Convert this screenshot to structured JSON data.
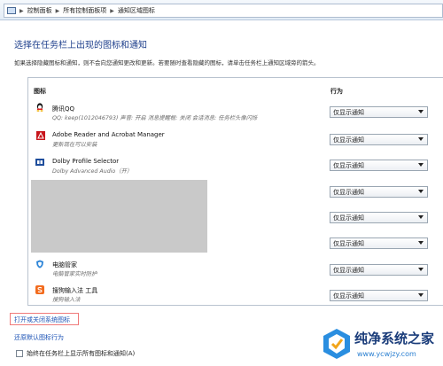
{
  "breadcrumb": [
    "控制面板",
    "所有控制面板项",
    "通知区域图标"
  ],
  "page_title": "选择在任务栏上出现的图标和通知",
  "description": "如果选择隐藏图标和通知，则不会向您通知更改和更新。若要随时查看隐藏的图标，请单击任务栏上通知区域旁的箭头。",
  "columns": {
    "icon": "图标",
    "behavior": "行为"
  },
  "rows": [
    {
      "name": "腾讯QQ",
      "desc": "QQ: keep(1012046793)  声音: 开启  消息提醒框: 关闭  会话消息: 任务栏头像闪烁",
      "behavior": "仅显示通知",
      "icon": "qq-icon"
    },
    {
      "name": "Adobe Reader and Acrobat Manager",
      "desc": "更新现在可以安装",
      "behavior": "仅显示通知",
      "icon": "adobe-icon"
    },
    {
      "name": "Dolby Profile Selector",
      "desc": "Dolby Advanced Audio（开）",
      "behavior": "仅显示通知",
      "icon": "dolby-icon"
    },
    {
      "name": "",
      "desc": "",
      "behavior": "仅显示通知",
      "icon": ""
    },
    {
      "name": "",
      "desc": "",
      "behavior": "仅显示通知",
      "icon": ""
    },
    {
      "name": "",
      "desc": "",
      "behavior": "仅显示通知",
      "icon": ""
    },
    {
      "name": "电脑管家",
      "desc": "电脑管家实时防护",
      "behavior": "仅显示通知",
      "icon": "shield-icon"
    },
    {
      "name": "搜狗输入法 工具",
      "desc": "搜狗输入法",
      "behavior": "仅显示通知",
      "icon": "sogou-icon"
    }
  ],
  "links": {
    "toggle_system_icons": "打开或关闭系统图标",
    "restore_defaults": "还原默认图标行为"
  },
  "checkbox_label": "始终在任务栏上显示所有图标和通知(A)",
  "watermark": {
    "title": "纯净系统之家",
    "url": "www.ycwjzy.com"
  },
  "colors": {
    "title": "#1e3f8c",
    "link": "#1a51b5",
    "highlight": "#f07a7a"
  }
}
